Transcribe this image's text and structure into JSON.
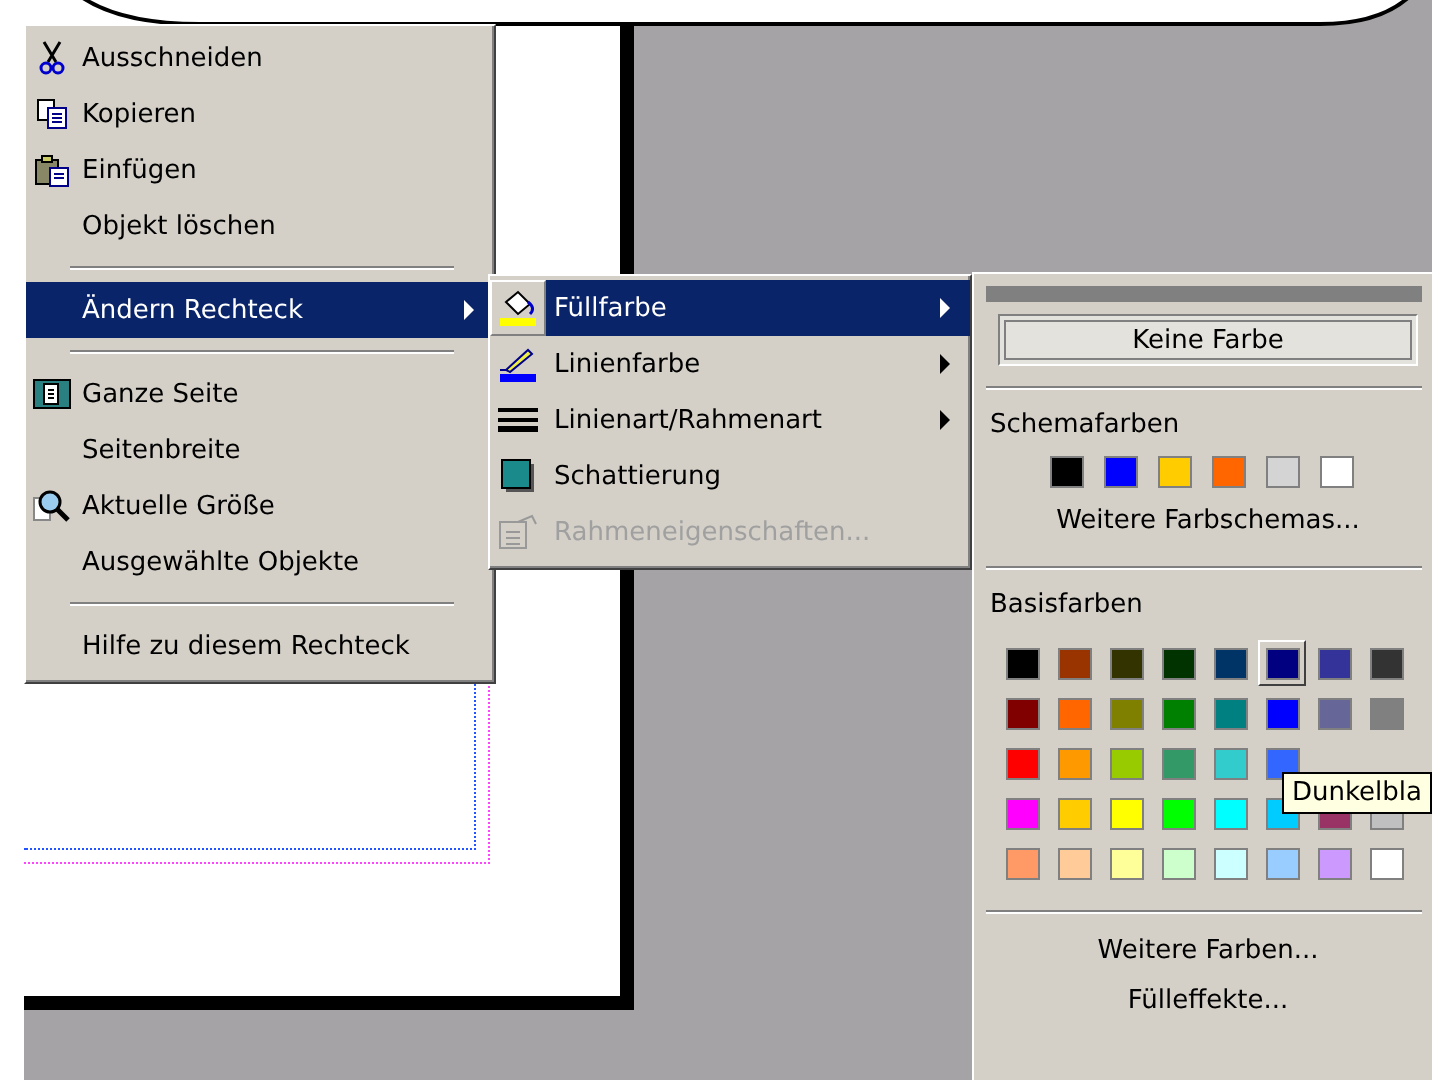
{
  "context_menu": {
    "items": [
      {
        "kind": "item",
        "label": "Ausschneiden",
        "selected": false,
        "submenu": false
      },
      {
        "kind": "item",
        "label": "Kopieren",
        "selected": false,
        "submenu": false
      },
      {
        "kind": "item",
        "label": "Einfügen",
        "selected": false,
        "submenu": false
      },
      {
        "kind": "item",
        "label": "Objekt löschen",
        "selected": false,
        "submenu": false
      },
      {
        "kind": "separator"
      },
      {
        "kind": "item",
        "label": "Ändern Rechteck",
        "selected": true,
        "submenu": true
      },
      {
        "kind": "separator"
      },
      {
        "kind": "item",
        "label": "Ganze Seite",
        "selected": false,
        "submenu": false
      },
      {
        "kind": "item",
        "label": "Seitenbreite",
        "selected": false,
        "submenu": false
      },
      {
        "kind": "item",
        "label": "Aktuelle Größe",
        "selected": false,
        "submenu": false
      },
      {
        "kind": "item",
        "label": "Ausgewählte Objekte",
        "selected": false,
        "submenu": false
      },
      {
        "kind": "separator"
      },
      {
        "kind": "item",
        "label": "Hilfe zu diesem Rechteck",
        "selected": false,
        "submenu": false
      }
    ]
  },
  "submenu": {
    "items": [
      {
        "label": "Füllfarbe",
        "selected": true,
        "disabled": false,
        "submenu": true
      },
      {
        "label": "Linienfarbe",
        "selected": false,
        "disabled": false,
        "submenu": true
      },
      {
        "label": "Linienart/Rahmenart",
        "selected": false,
        "disabled": false,
        "submenu": true
      },
      {
        "label": "Schattierung",
        "selected": false,
        "disabled": false,
        "submenu": false
      },
      {
        "label": "Rahmeneigenschaften...",
        "selected": false,
        "disabled": true,
        "submenu": false
      }
    ]
  },
  "color_panel": {
    "no_color_button": "Keine Farbe",
    "scheme_label": "Schemafarben",
    "scheme_colors": [
      {
        "color": "#000000"
      },
      {
        "color": "#0000ff"
      },
      {
        "color": "#ffcc00"
      },
      {
        "color": "#ff6600"
      },
      {
        "color": "#d4d4d4"
      },
      {
        "color": "#ffffff"
      }
    ],
    "more_schemes": "Weitere Farbschemas...",
    "basic_label": "Basisfarben",
    "basic_rows": [
      [
        {
          "color": "#000000",
          "selected": false
        },
        {
          "color": "#993300",
          "selected": false
        },
        {
          "color": "#333300",
          "selected": false
        },
        {
          "color": "#003300",
          "selected": false
        },
        {
          "color": "#003366",
          "selected": false
        },
        {
          "color": "#000080",
          "selected": true
        },
        {
          "color": "#333399",
          "selected": false
        },
        {
          "color": "#333333",
          "selected": false
        }
      ],
      [
        {
          "color": "#800000",
          "selected": false
        },
        {
          "color": "#ff6600",
          "selected": false
        },
        {
          "color": "#808000",
          "selected": false
        },
        {
          "color": "#008000",
          "selected": false
        },
        {
          "color": "#008080",
          "selected": false
        },
        {
          "color": "#0000ff",
          "selected": false
        },
        {
          "color": "#666699",
          "selected": false
        },
        {
          "color": "#808080",
          "selected": false
        }
      ],
      [
        {
          "color": "#ff0000",
          "selected": false
        },
        {
          "color": "#ff9900",
          "selected": false
        },
        {
          "color": "#99cc00",
          "selected": false
        },
        {
          "color": "#339966",
          "selected": false
        },
        {
          "color": "#33cccc",
          "selected": false
        },
        {
          "color": "#3366ff",
          "selected": false
        }
      ],
      [
        {
          "color": "#ff00ff",
          "selected": false
        },
        {
          "color": "#ffcc00",
          "selected": false
        },
        {
          "color": "#ffff00",
          "selected": false
        },
        {
          "color": "#00ff00",
          "selected": false
        },
        {
          "color": "#00ffff",
          "selected": false
        },
        {
          "color": "#00ccff",
          "selected": false
        },
        {
          "color": "#993366",
          "selected": false
        },
        {
          "color": "#c0c0c0",
          "selected": false
        }
      ],
      [
        {
          "color": "#ff9966",
          "selected": false
        },
        {
          "color": "#ffcc99",
          "selected": false
        },
        {
          "color": "#ffff99",
          "selected": false
        },
        {
          "color": "#ccffcc",
          "selected": false
        },
        {
          "color": "#ccffff",
          "selected": false
        },
        {
          "color": "#99ccff",
          "selected": false
        },
        {
          "color": "#cc99ff",
          "selected": false
        },
        {
          "color": "#ffffff",
          "selected": false
        }
      ]
    ],
    "tooltip": "Dunkelbla",
    "more_colors": "Weitere Farben...",
    "fill_effects": "Fülleffekte..."
  }
}
